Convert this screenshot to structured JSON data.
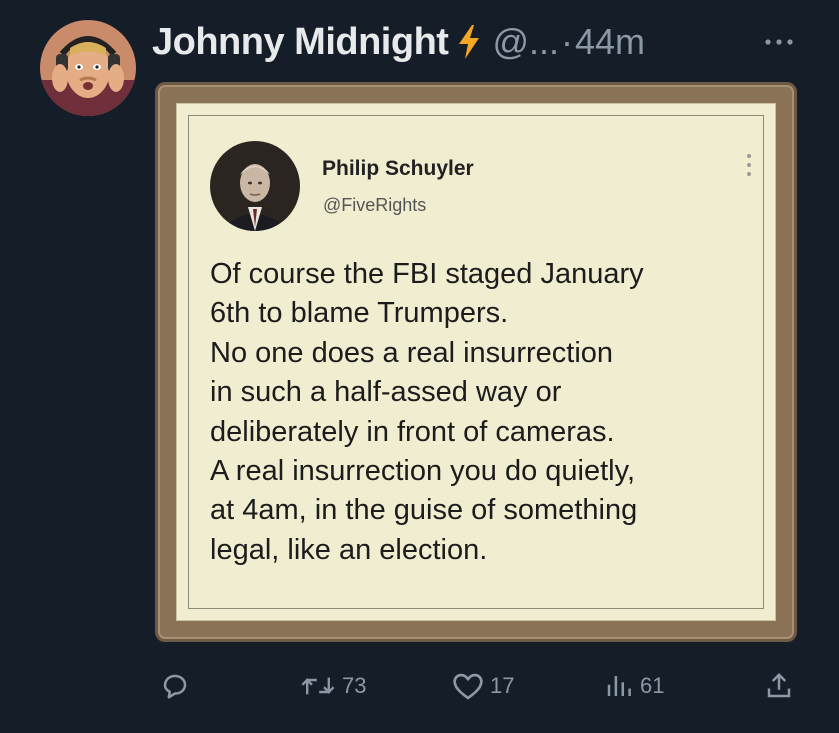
{
  "author": {
    "name": "Johnny Midnight",
    "handle": "@...",
    "separator": "·",
    "time": "44m",
    "more_icon": "more-horizontal-icon"
  },
  "image_post": {
    "name": "Philip Schuyler",
    "handle": "@FiveRights",
    "lines": [
      "Of course the FBI staged January",
      "6th to blame Trumpers.",
      "No one does a real insurrection",
      "in such a half-assed way or",
      "deliberately in front of cameras.",
      "A real insurrection you do quietly,",
      "at 4am, in the guise of something",
      "legal, like an election."
    ]
  },
  "actions": {
    "reply": {
      "icon": "reply-icon",
      "count": ""
    },
    "repost": {
      "icon": "repost-icon",
      "count": "73"
    },
    "like": {
      "icon": "heart-icon",
      "count": "17"
    },
    "views": {
      "icon": "views-icon",
      "count": "61"
    },
    "share": {
      "icon": "share-icon"
    }
  },
  "colors": {
    "background": "#151d28",
    "text_primary": "#e7e9ea",
    "text_secondary": "#8b98a5",
    "bolt": "#f5a623",
    "paper": "#f1edd0",
    "frame": "#8a7257"
  }
}
